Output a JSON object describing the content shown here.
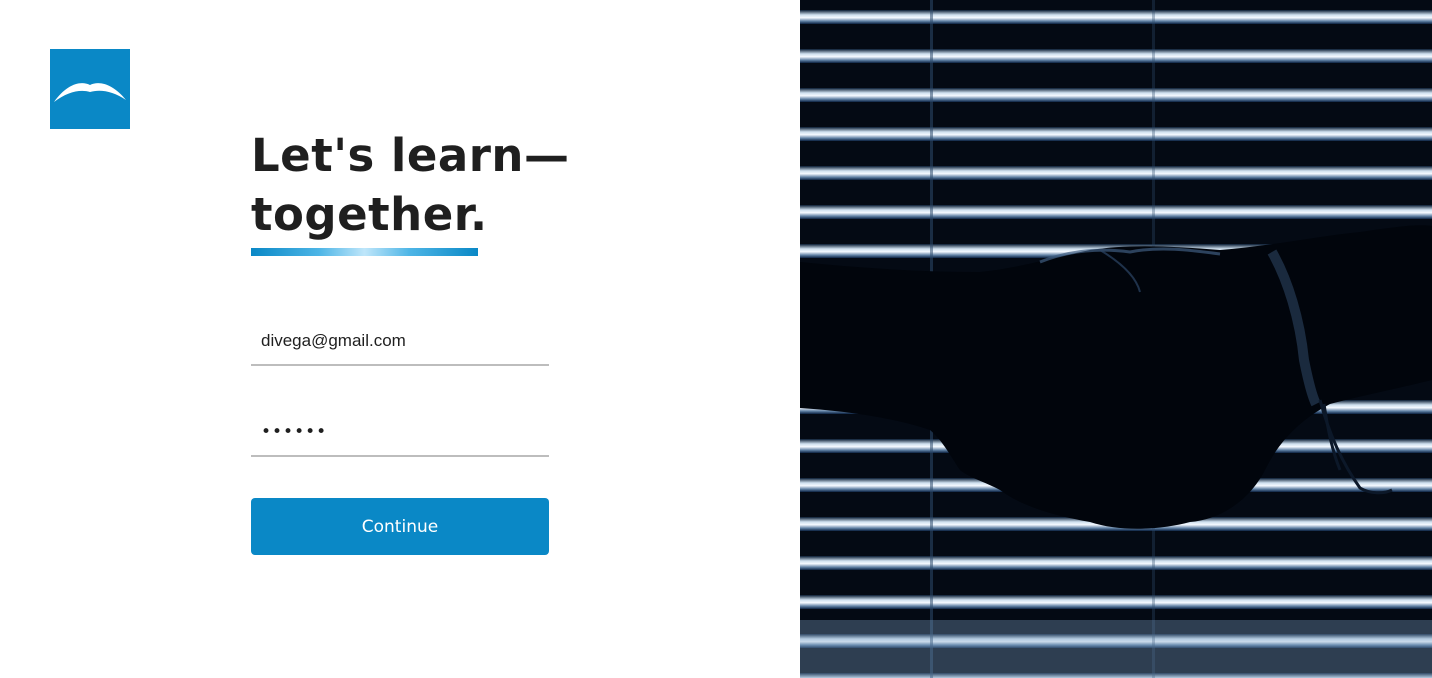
{
  "brand": {
    "logo_icon": "bird-wing-logo-icon",
    "color": "#0a88c6"
  },
  "headline": {
    "line1": "Let's learn—",
    "line2": "together."
  },
  "form": {
    "email_value": "divega@gmail.com",
    "password_value": "123456",
    "continue_label": "Continue"
  },
  "hero_image": {
    "icon": "handshake-photo"
  }
}
